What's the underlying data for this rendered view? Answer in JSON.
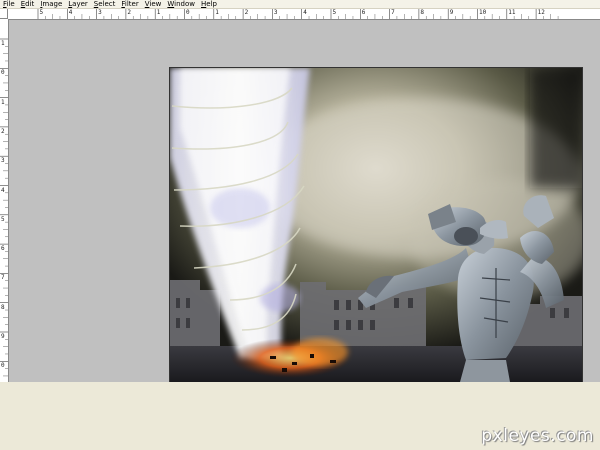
{
  "menubar": {
    "items": [
      "File",
      "Edit",
      "Image",
      "Layer",
      "Select",
      "Filter",
      "View",
      "Window",
      "Help"
    ]
  },
  "rulers": {
    "horizontal_labels": [
      "5",
      "4",
      "3",
      "2",
      "1",
      "0",
      "1",
      "2",
      "3",
      "4",
      "5",
      "6",
      "7",
      "8",
      "9",
      "10",
      "11",
      "12"
    ],
    "vertical_labels": [
      "1",
      "0",
      "1",
      "2",
      "3",
      "4",
      "5",
      "6",
      "7",
      "8",
      "9",
      "0"
    ]
  },
  "canvas": {
    "description_icon": "tornado-robot-artwork"
  },
  "watermark": "pxleyes.com"
}
